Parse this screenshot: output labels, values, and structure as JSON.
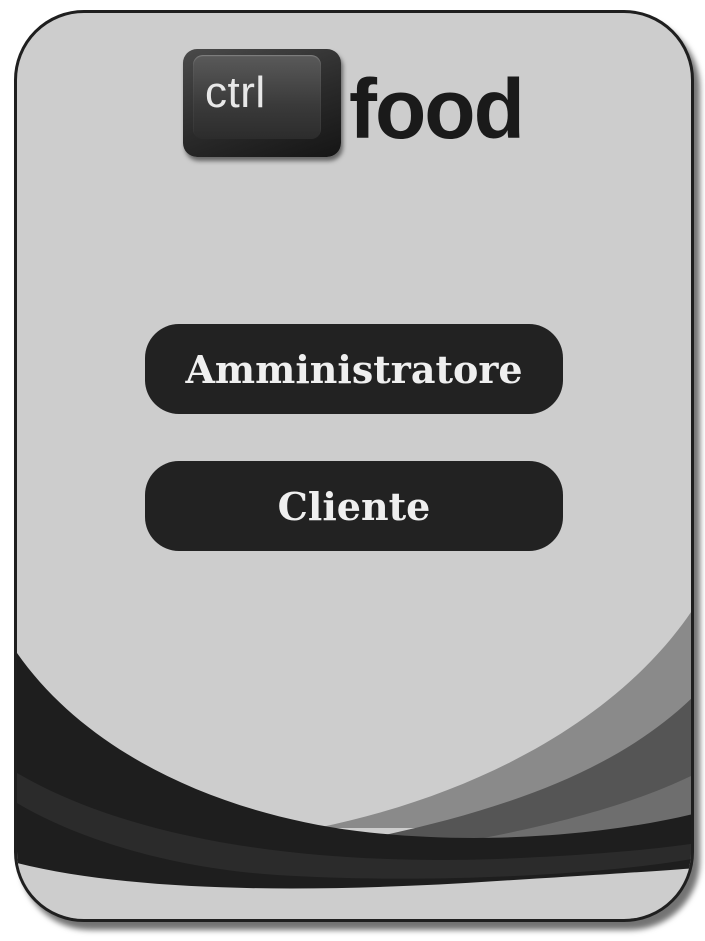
{
  "logo": {
    "key_text": "ctrl",
    "brand_text": "food"
  },
  "menu": {
    "admin_label": "Amministratore",
    "client_label": "Cliente"
  },
  "colors": {
    "card_background": "#cdcdcd",
    "button_background": "#222222",
    "button_text": "#efefef",
    "wave_dark": "#1e1e1e",
    "wave_mid": "#555555",
    "wave_light": "#8a8a8a"
  }
}
